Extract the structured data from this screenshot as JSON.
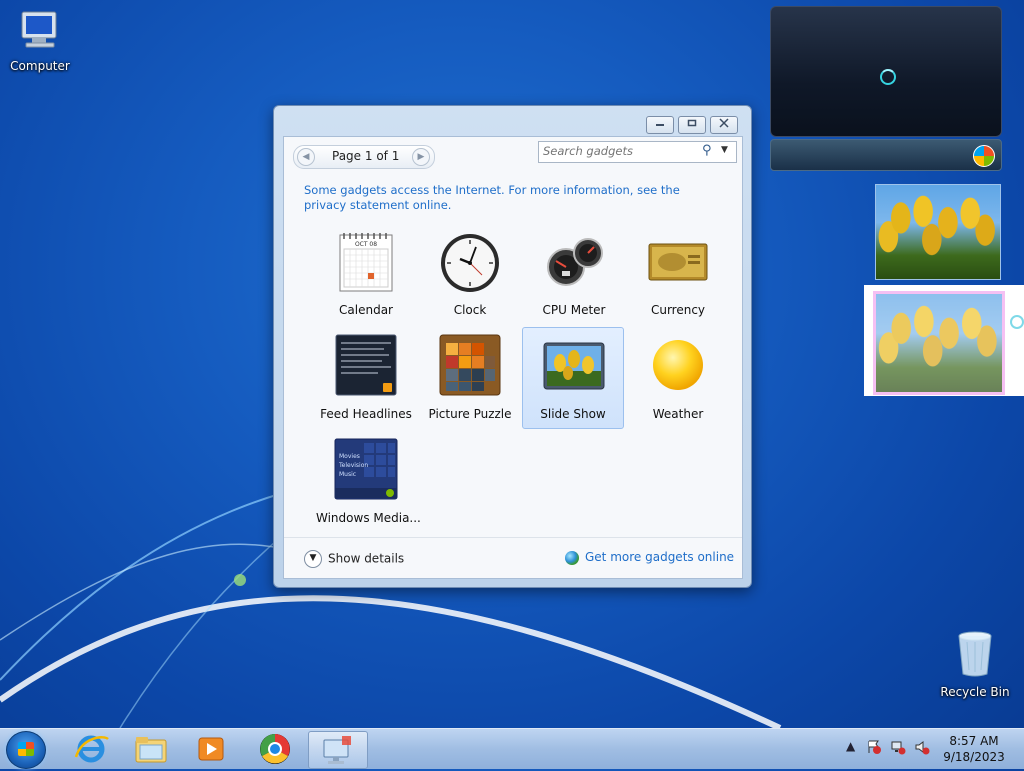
{
  "desktop": {
    "icons": [
      {
        "label": "Computer"
      },
      {
        "label": "Recycle Bin"
      }
    ]
  },
  "gallery": {
    "pager_label": "Page 1 of 1",
    "search_placeholder": "Search gadgets",
    "notice": "Some gadgets access the Internet.  For more information, see the privacy statement online.",
    "gadgets": [
      {
        "label": "Calendar",
        "icon": "calendar-icon"
      },
      {
        "label": "Clock",
        "icon": "clock-icon"
      },
      {
        "label": "CPU Meter",
        "icon": "cpu-meter-icon"
      },
      {
        "label": "Currency",
        "icon": "currency-icon"
      },
      {
        "label": "Feed Headlines",
        "icon": "feed-headlines-icon"
      },
      {
        "label": "Picture Puzzle",
        "icon": "picture-puzzle-icon"
      },
      {
        "label": "Slide Show",
        "icon": "slide-show-icon",
        "selected": true
      },
      {
        "label": "Weather",
        "icon": "weather-icon"
      },
      {
        "label": "Windows Media...",
        "icon": "windows-media-center-icon"
      }
    ],
    "show_details": "Show details",
    "get_more": "Get more gadgets online",
    "calendar_month": "OCT 08",
    "media_center_items": [
      "Movies",
      "Television",
      "Music"
    ]
  },
  "taskbar": {
    "pinned": [
      "internet-explorer-icon",
      "file-explorer-icon",
      "media-player-icon",
      "chrome-icon",
      "gadgets-icon"
    ],
    "time": "8:57 AM",
    "date": "9/18/2023"
  },
  "colors": {
    "link": "#1f6ec9",
    "selection_border": "#f2a6ef"
  }
}
